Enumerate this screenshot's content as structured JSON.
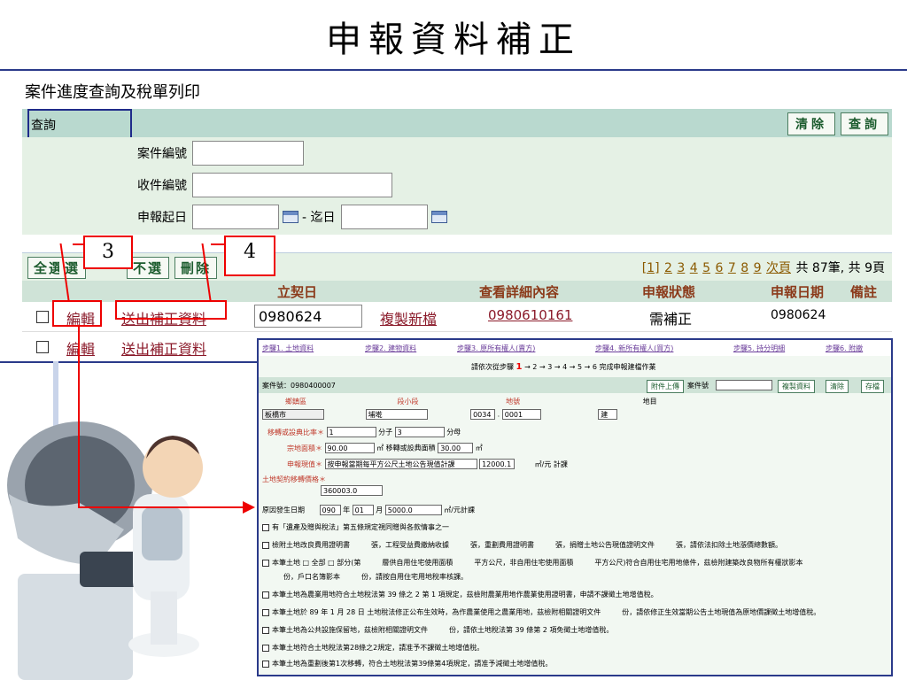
{
  "slide_title": "申報資料補正",
  "section_title": "案件進度查詢及稅單列印",
  "query": {
    "label": "查詢",
    "clear_btn": "清除",
    "search_btn": "查詢",
    "fields": {
      "case_no_label": "案件編號",
      "receipt_no_label": "收件編號",
      "date_from_label": "申報起日",
      "date_to_sep": "- 迄日"
    }
  },
  "list": {
    "btn_all": "全選",
    "btn_select_prefix": "選",
    "btn_unselect": "不選",
    "btn_delete": "刪除",
    "pager_pages": [
      "[1]",
      "2",
      "3",
      "4",
      "5",
      "6",
      "7",
      "8",
      "9"
    ],
    "pager_next": "次頁",
    "pager_summary": "共 87筆, 共 9頁",
    "headers": {
      "contract_date": "立契日",
      "detail": "查看詳細內容",
      "status": "申報狀態",
      "report_date": "申報日期",
      "note": "備註"
    },
    "rows": [
      {
        "edit": "編輯",
        "submit": "送出補正資料",
        "contract_date": "0980624",
        "copy": "複製新檔",
        "detail_no": "0980610161",
        "status": "需補正",
        "report_date": "0980624"
      },
      {
        "edit": "編輯",
        "submit": "送出補正資料"
      }
    ]
  },
  "callouts": [
    "3",
    "4"
  ],
  "form": {
    "steps": [
      "步驟1. 土地資料",
      "步驟2. 建物資料",
      "步驟3. 原所有權人(賣方)",
      "步驟4. 新所有權人(買方)",
      "步驟5. 持分明細",
      "步驟6. 附繳"
    ],
    "hint_prefix": "請依次從步驟",
    "hint_num": "1",
    "hint_suffix": "→ 2 → 3 → 4 → 5 → 6 完成申報建檔作業",
    "case_label": "案件號：0980400007",
    "btn_attach": "附件上傳",
    "case_no_label": "案件號",
    "btn_copy": "複製資料",
    "btn_clear": "清除",
    "btn_save": "存檔",
    "col_town": "鄉鎮區",
    "col_section": "段小段",
    "col_lot": "地號",
    "col_landuse": "地目",
    "town_value": "板橋市",
    "section_value": "埔墘",
    "lot_a": "0034",
    "lot_b": "0001",
    "landuse_value": "建",
    "ratio_label": "移轉或設典比率＊",
    "ratio_num": "1",
    "ratio_den_label": "分子",
    "ratio_den": "3",
    "ratio_unit": "分母",
    "area_label": "宗地面積＊",
    "area_value": "90.00",
    "area_unit": "㎡ 移轉或設典面積",
    "area_transfer": "30.00",
    "sq_unit": "㎡",
    "value_label": "申報現值＊",
    "value_select": "按申報當期每平方公尺土地公告現值計課",
    "value_amount": "12000.1",
    "value_unit": "㎡/元 計課",
    "contract_label": "土地契約移轉價格＊",
    "contract_value": "360003.0",
    "origin_label": "原因發生日期",
    "origin_y": "090",
    "origin_m": "01",
    "origin_price": "5000.0",
    "year": "年",
    "month": "月",
    "origin_unit": "㎡/元計課",
    "checks": [
      "有「遺產及贈與稅法」第五條規定視同贈與各款情事之一",
      "檢附土地改良費用證明書　　　張，工程受益費繳納收據　　　張，重劃費用證明書　　　張，捐贈土地公告現值證明文件　　　張，請依法扣除土地漲價總數額。",
      "本筆土地 □ 全部 □ 部分(第　　　層供自用住宅使用面積　　　平方公尺，非自用住宅使用面積　　　平方公尺)符合自用住宅用地條件，茲檢附建築改良物所有權狀影本",
      "　　　份，戶口名簿影本　　　份，請按自用住宅用地稅率核課。",
      "本筆土地為農業用地符合土地稅法第 39 條之 2 第 1 項規定，茲檢附農業用地作農業使用證明書，申請不課徵土地增值稅。",
      "本筆土地於 89 年 1 月 28 日 土地稅法修正公布生效時，為作農業使用之農業用地，茲檢附相關證明文件　　　份，請依修正生效當期公告土地現值為原地價課徵土地增值稅。",
      "本筆土地為公共設施保留地，茲檢附相關證明文件　　　份，請依土地稅法第 39 條第 2 項免徵土地增值稅。",
      "本筆土地符合土地稅法第28條之2規定，請准予不課徵土地增值稅。",
      "本筆土地為重劃後第1次移轉，符合土地稅法第39條第4項規定，請准予減徵土地增值稅。"
    ]
  },
  "colors": {
    "accent_green": "#b9d9cf",
    "callout_red": "#e00000",
    "border_blue": "#2a3a8a"
  }
}
